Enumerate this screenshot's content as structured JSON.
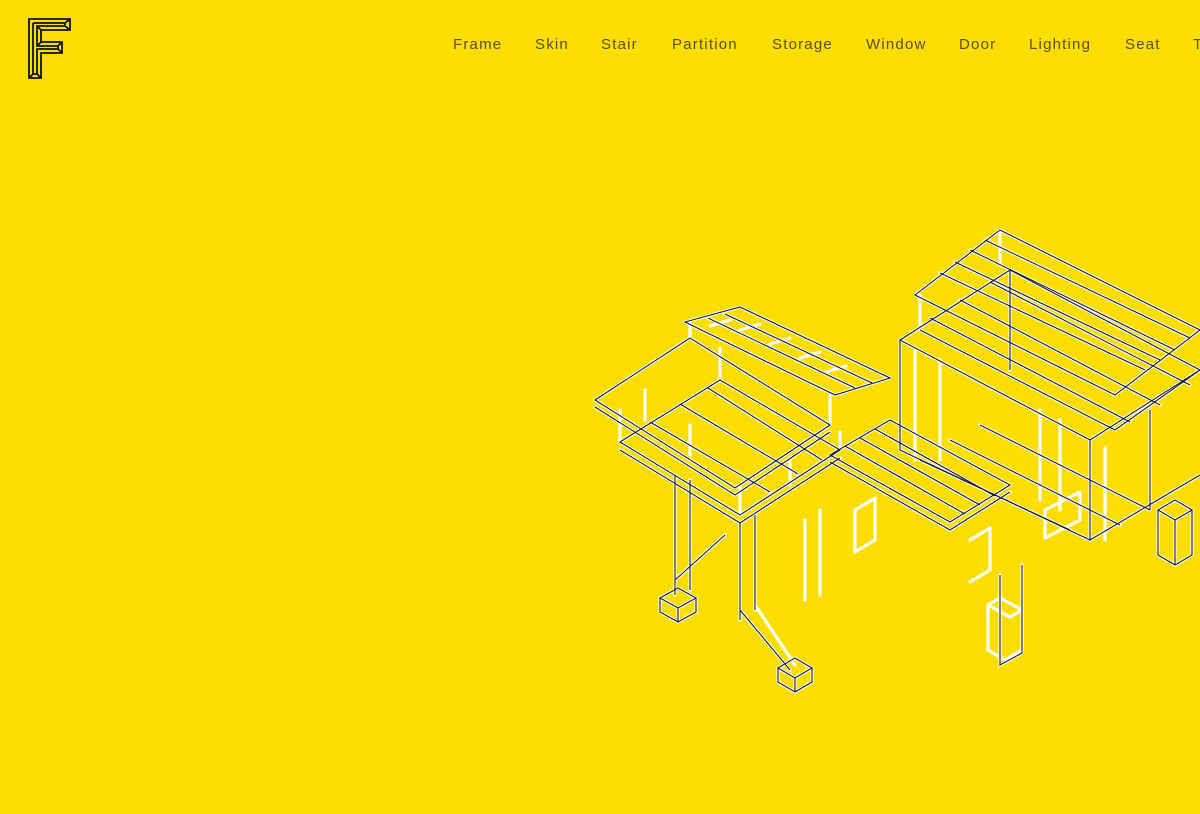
{
  "colors": {
    "background": "#FEDD00",
    "nav_text": "#5b4f14",
    "line_white": "#ffffff",
    "line_dark": "#1a1a1a",
    "logo_stroke": "#111111"
  },
  "logo": {
    "letter": "F",
    "icon": "geometric-f-logo-icon"
  },
  "nav": {
    "items": [
      {
        "label": "Frame"
      },
      {
        "label": "Skin"
      },
      {
        "label": "Stair"
      },
      {
        "label": "Partition"
      },
      {
        "label": "Storage"
      },
      {
        "label": "Window"
      },
      {
        "label": "Door"
      },
      {
        "label": "Lighting"
      },
      {
        "label": "Seat"
      },
      {
        "label": "T"
      }
    ]
  },
  "illustration": {
    "icon": "isometric-house-frame-icon"
  }
}
